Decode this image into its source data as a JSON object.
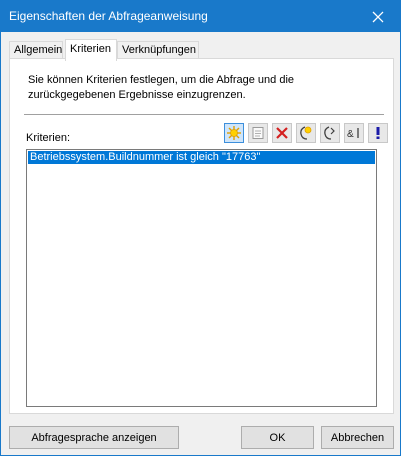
{
  "window": {
    "title": "Eigenschaften der Abfrageanweisung",
    "titlebar_color": "#1979ca"
  },
  "tabs": [
    {
      "label": "Allgemein",
      "active": false
    },
    {
      "label": "Kriterien",
      "active": true
    },
    {
      "label": "Verknüpfungen",
      "active": false
    }
  ],
  "panel": {
    "description": "Sie können Kriterien festlegen, um die Abfrage und die zurückgegebenen Ergebnisse einzugrenzen.",
    "criteria_label": "Kriterien:",
    "toolbar_icons": [
      "new-criterion-icon",
      "properties-icon",
      "delete-icon",
      "group-icon",
      "ungroup-icon",
      "and-or-icon",
      "not-icon"
    ],
    "criteria_items": [
      {
        "text": "Betriebssystem.Buildnummer ist gleich \"17763\"",
        "selected": true
      }
    ],
    "selection_color": "#0078d7"
  },
  "buttons": {
    "show_query_language": "Abfragesprache anzeigen",
    "ok": "OK",
    "cancel": "Abbrechen"
  }
}
